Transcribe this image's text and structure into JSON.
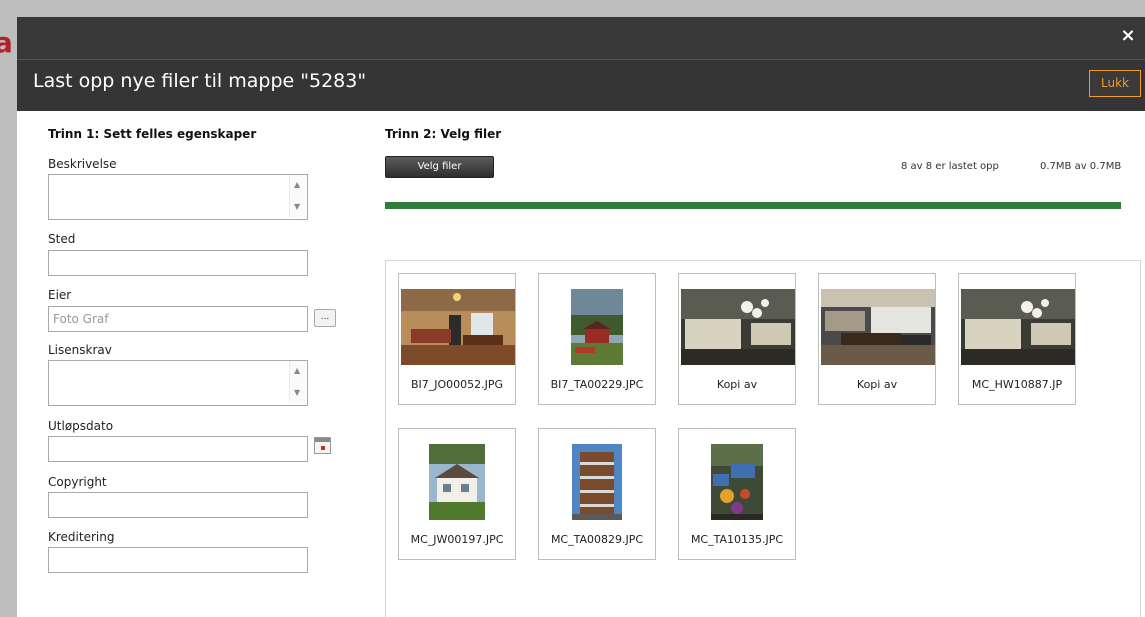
{
  "backdrop": {
    "letter": "a"
  },
  "dialog": {
    "title": "Last opp nye filer til mappe \"5283\"",
    "close_label": "Lukk",
    "close_icon": "×"
  },
  "step1": {
    "heading": "Trinn 1: Sett felles egenskaper",
    "fields": {
      "beskrivelse": {
        "label": "Beskrivelse",
        "value": ""
      },
      "sted": {
        "label": "Sted",
        "value": ""
      },
      "eier": {
        "label": "Eier",
        "value": "Foto Graf"
      },
      "lisenskrav": {
        "label": "Lisenskrav",
        "value": ""
      },
      "utlopsdato": {
        "label": "Utløpsdato",
        "value": ""
      },
      "copyright": {
        "label": "Copyright",
        "value": ""
      },
      "kreditering": {
        "label": "Kreditering",
        "value": ""
      }
    },
    "browse_label": "..."
  },
  "step2": {
    "heading": "Trinn 2: Velg filer",
    "choose_files_label": "Velg filer",
    "count_status": "8 av 8 er lastet opp",
    "size_status": "0.7MB av 0.7MB",
    "progress_percent": 100,
    "progress_color": "#2e7d3b",
    "files": [
      {
        "name": "BI7_JO00052.JPG"
      },
      {
        "name": "BI7_TA00229.JPC"
      },
      {
        "name": "Kopi av"
      },
      {
        "name": "Kopi av"
      },
      {
        "name": "MC_HW10887.JP"
      },
      {
        "name": "MC_JW00197.JPC"
      },
      {
        "name": "MC_TA00829.JPC"
      },
      {
        "name": "MC_TA10135.JPC"
      }
    ]
  }
}
